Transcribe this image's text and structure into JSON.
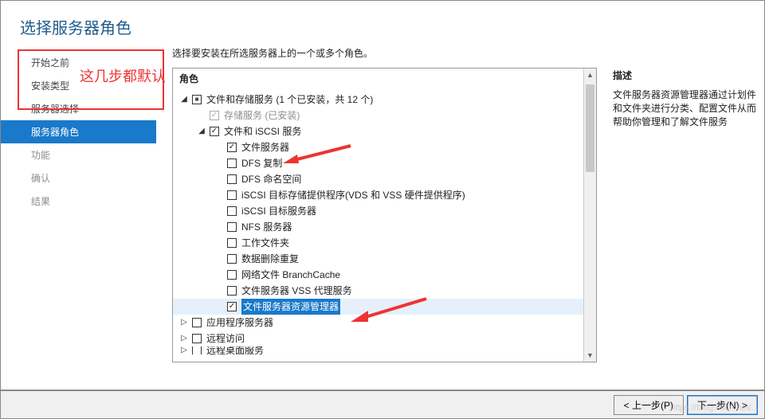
{
  "title": "选择服务器角色",
  "instruction": "选择要安装在所选服务器上的一个或多个角色。",
  "sidebar": {
    "items": [
      {
        "label": "开始之前",
        "state": "default"
      },
      {
        "label": "安装类型",
        "state": "default"
      },
      {
        "label": "服务器选择",
        "state": "default"
      },
      {
        "label": "服务器角色",
        "state": "selected"
      },
      {
        "label": "功能",
        "state": "disabled"
      },
      {
        "label": "确认",
        "state": "disabled"
      },
      {
        "label": "结果",
        "state": "disabled"
      }
    ]
  },
  "tree_header": "角色",
  "tree": [
    {
      "indent": 0,
      "expander": "open",
      "check": "mixed",
      "label": "文件和存储服务 (1 个已安装，共 12 个)"
    },
    {
      "indent": 1,
      "expander": "none",
      "check": "checked-disabled",
      "label": "存储服务 (已安装)",
      "disabled": true
    },
    {
      "indent": 1,
      "expander": "open",
      "check": "checked",
      "label": "文件和 iSCSI 服务"
    },
    {
      "indent": 2,
      "expander": "none",
      "check": "checked",
      "label": "文件服务器"
    },
    {
      "indent": 2,
      "expander": "none",
      "check": "unchecked",
      "label": "DFS 复制"
    },
    {
      "indent": 2,
      "expander": "none",
      "check": "unchecked",
      "label": "DFS 命名空间"
    },
    {
      "indent": 2,
      "expander": "none",
      "check": "unchecked",
      "label": "iSCSI 目标存储提供程序(VDS 和 VSS 硬件提供程序)"
    },
    {
      "indent": 2,
      "expander": "none",
      "check": "unchecked",
      "label": "iSCSI 目标服务器"
    },
    {
      "indent": 2,
      "expander": "none",
      "check": "unchecked",
      "label": "NFS 服务器"
    },
    {
      "indent": 2,
      "expander": "none",
      "check": "unchecked",
      "label": "工作文件夹"
    },
    {
      "indent": 2,
      "expander": "none",
      "check": "unchecked",
      "label": "数据删除重复"
    },
    {
      "indent": 2,
      "expander": "none",
      "check": "unchecked",
      "label": "网络文件 BranchCache"
    },
    {
      "indent": 2,
      "expander": "none",
      "check": "unchecked",
      "label": "文件服务器 VSS 代理服务"
    },
    {
      "indent": 2,
      "expander": "none",
      "check": "checked",
      "label": "文件服务器资源管理器",
      "highlight": true
    },
    {
      "indent": 0,
      "expander": "closed",
      "check": "unchecked",
      "label": "应用程序服务器"
    },
    {
      "indent": 0,
      "expander": "closed",
      "check": "unchecked",
      "label": "远程访问"
    },
    {
      "indent": 0,
      "expander": "closed",
      "check": "unchecked",
      "label": "远程桌面服务",
      "cut": true
    }
  ],
  "description": {
    "heading": "描述",
    "body": "文件服务器资源管理器通过计划件和文件夹进行分类、配置文件从而帮助你管理和了解文件服务"
  },
  "buttons": {
    "prev": "< 上一步(P)",
    "next": "下一步(N) >"
  },
  "annotation_text": "这几步都默认",
  "watermark": "https://blog.csdn.net/..."
}
